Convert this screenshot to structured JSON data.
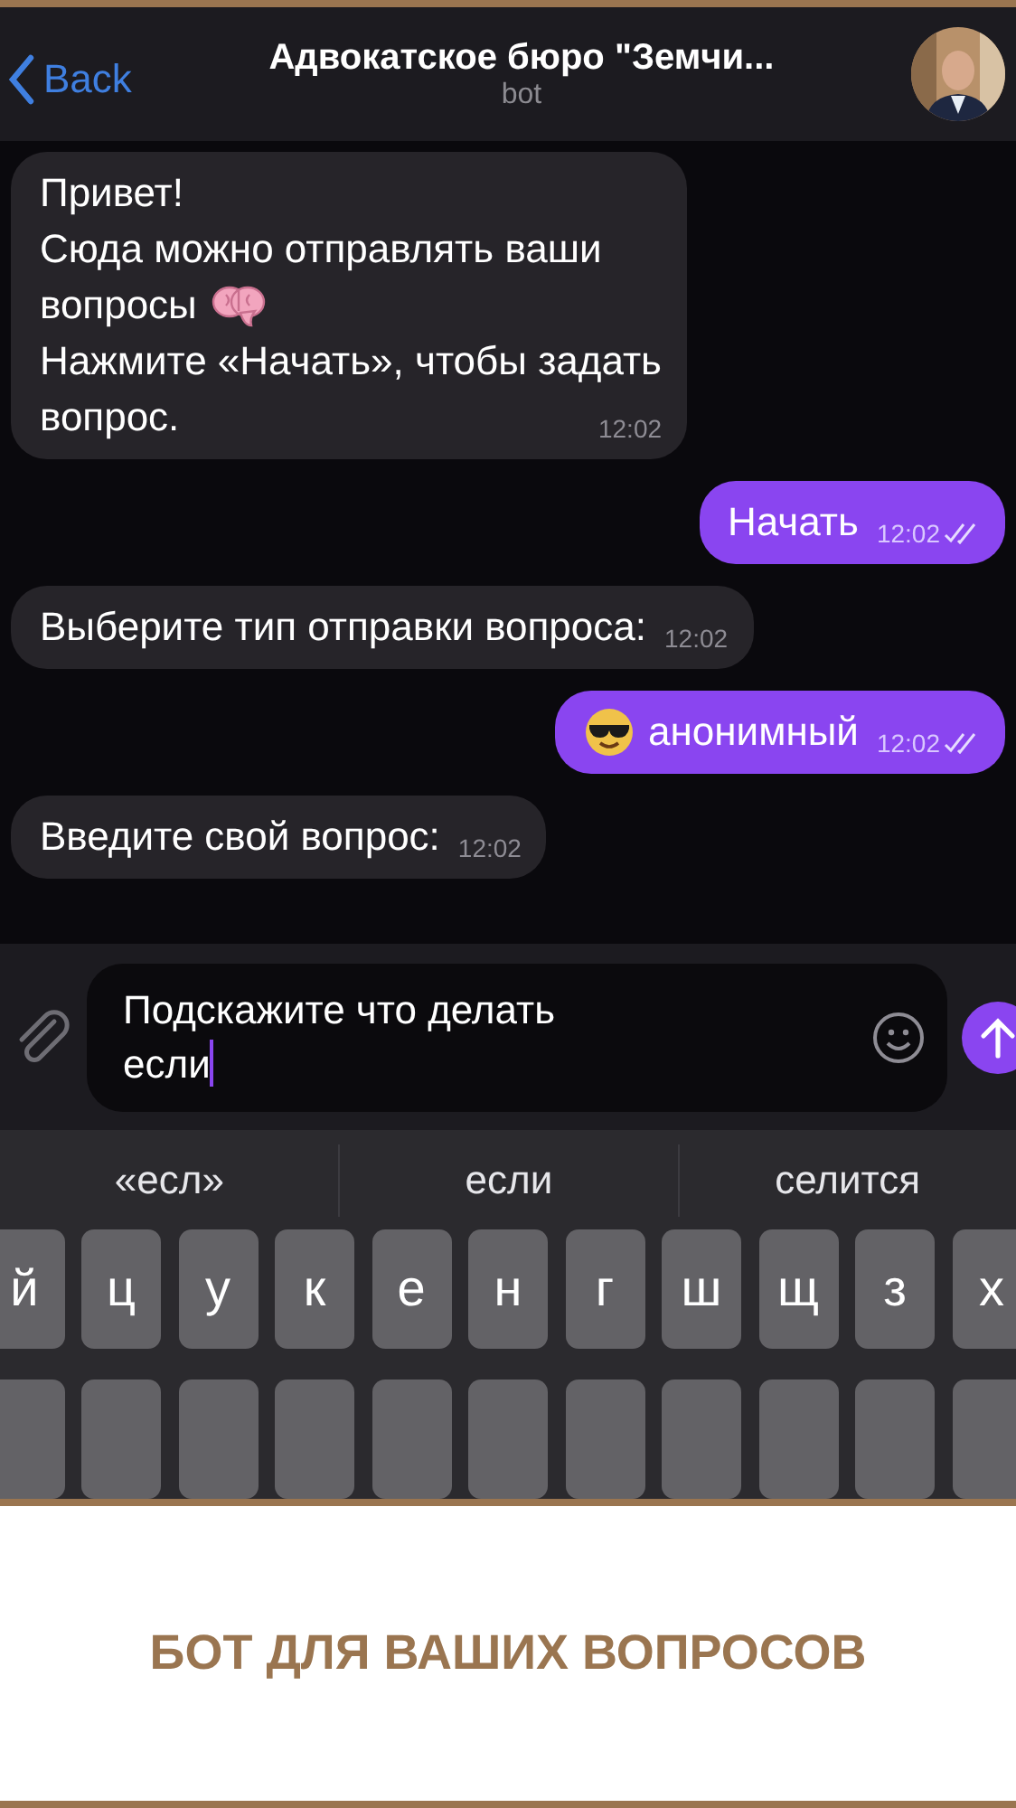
{
  "header": {
    "back_label": "Back",
    "title": "Адвокатское бюро \"Земчи...",
    "subtitle": "bot"
  },
  "messages": [
    {
      "kind": "incoming",
      "lines": [
        [
          {
            "kind": "text",
            "text": "Привет!"
          }
        ],
        [
          {
            "kind": "text",
            "text": "Сюда можно отправлять ваши"
          }
        ],
        [
          {
            "kind": "text",
            "text": "вопросы"
          },
          {
            "kind": "brain-emoji"
          }
        ],
        [
          {
            "kind": "text",
            "text": "Нажмите «Начать», чтобы задать"
          }
        ],
        [
          {
            "kind": "text",
            "text": "вопрос."
          }
        ]
      ],
      "time": "12:02",
      "read": false
    },
    {
      "kind": "outgoing",
      "lines": [
        [
          {
            "kind": "text",
            "text": "Начать"
          }
        ]
      ],
      "time": "12:02",
      "read": true
    },
    {
      "kind": "incoming",
      "lines": [
        [
          {
            "kind": "text",
            "text": "Выберите тип отправки вопроса:"
          }
        ]
      ],
      "time": "12:02",
      "read": false
    },
    {
      "kind": "outgoing",
      "lines": [
        [
          {
            "kind": "sunglasses-emoji"
          },
          {
            "kind": "text",
            "text": "анонимный"
          }
        ]
      ],
      "time": "12:02",
      "read": true
    },
    {
      "kind": "incoming",
      "lines": [
        [
          {
            "kind": "text",
            "text": "Введите свой вопрос:"
          }
        ]
      ],
      "time": "12:02",
      "read": false
    }
  ],
  "composer": {
    "value": "Подскажите что делать\nесли"
  },
  "keyboard": {
    "suggestions": [
      "«есл»",
      "если",
      "селится"
    ],
    "row_1": [
      "й",
      "ц",
      "у",
      "к",
      "е",
      "н",
      "г",
      "ш",
      "щ",
      "з",
      "х"
    ]
  },
  "caption": "БОТ ДЛЯ ВАШИХ ВОПРОСОВ"
}
